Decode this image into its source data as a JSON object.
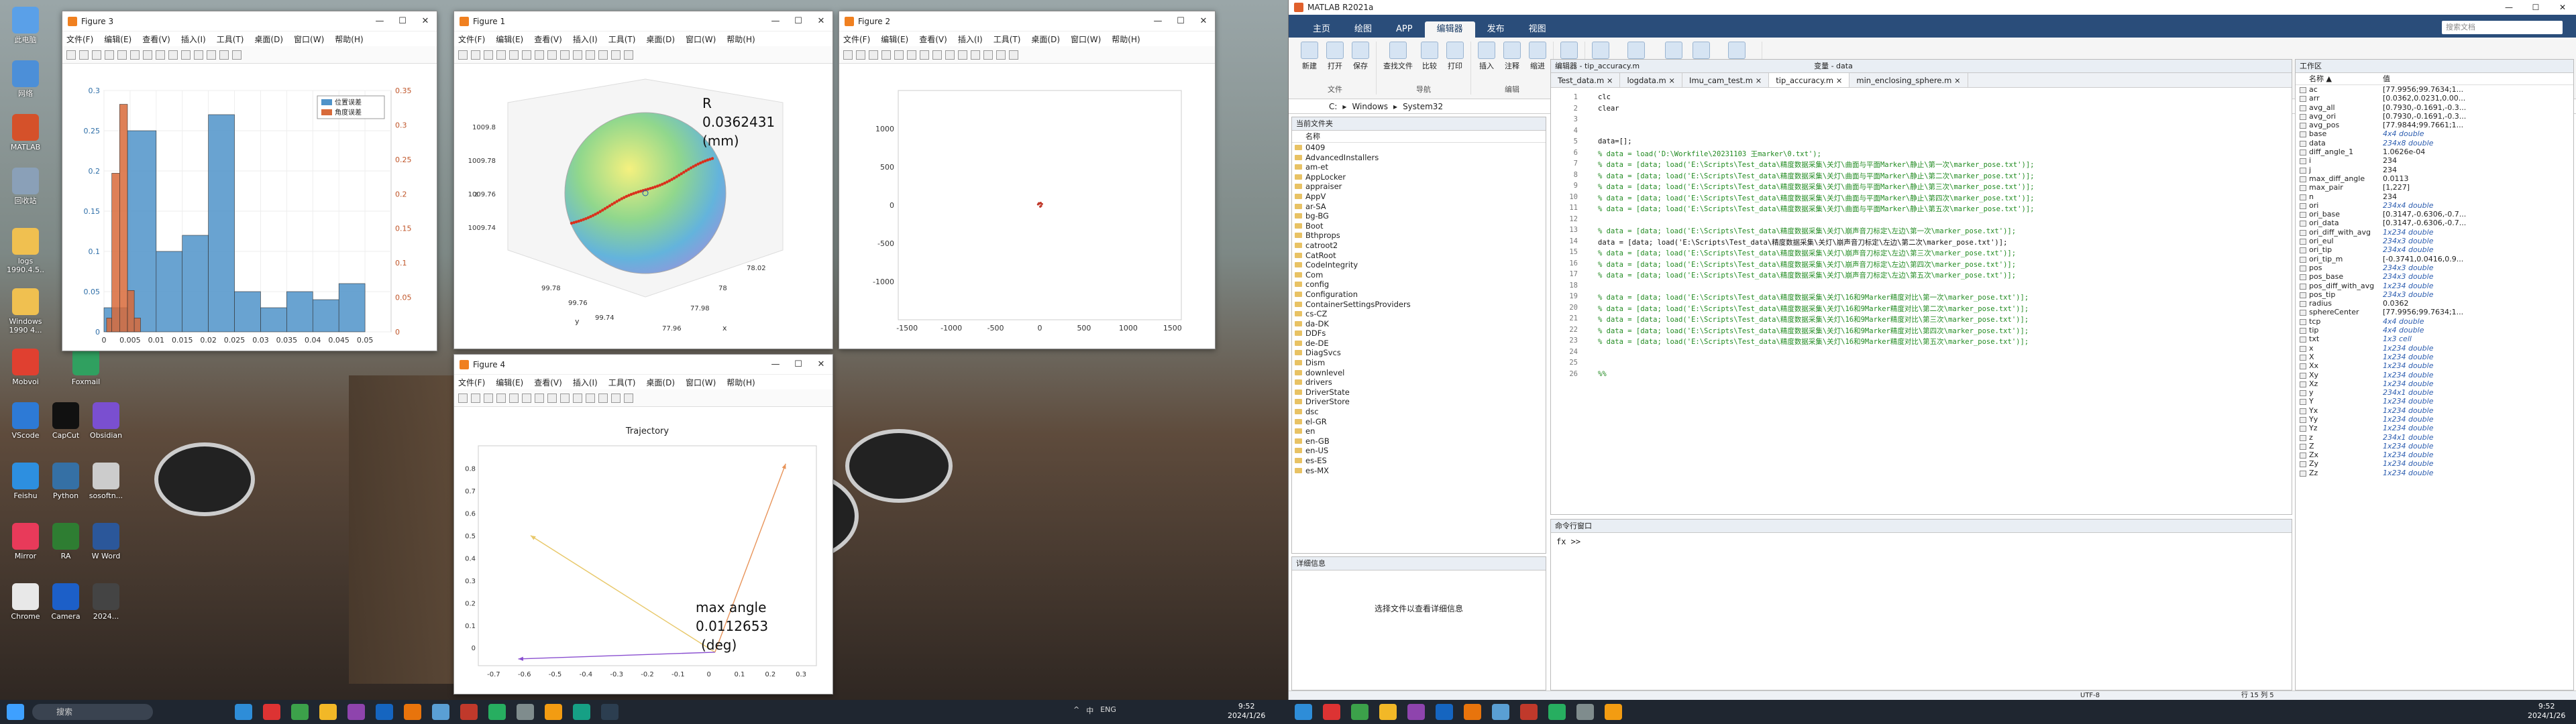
{
  "desktop": {
    "icons": [
      {
        "label": "此电脑",
        "color": "#5aa0e8"
      },
      {
        "label": "网络",
        "color": "#4c8fd8"
      },
      {
        "label": "MATLAB",
        "color": "#d5512a"
      },
      {
        "label": "回收站",
        "color": "#8aa0b8"
      },
      {
        "label": "logs\n1990.4.5..",
        "color": "#f0c050"
      },
      {
        "label": "Windows\n1990 4...",
        "color": "#f0c050"
      },
      {
        "label": "app",
        "color": "#f0c050"
      },
      {
        "label": "Mobvoi",
        "color": "#e04030"
      },
      {
        "label": "Foxmail",
        "color": "#30a060"
      },
      {
        "label": "VScode",
        "color": "#2d7ad6"
      },
      {
        "label": "CapCut",
        "color": "#111111"
      },
      {
        "label": "Obsidian",
        "color": "#7a4fd0"
      },
      {
        "label": "Feishu",
        "color": "#2d8fe0"
      },
      {
        "label": "Python",
        "color": "#3570a5"
      },
      {
        "label": "sosoftn...",
        "color": "#cccccc"
      },
      {
        "label": "Mirror",
        "color": "#e83a5a"
      },
      {
        "label": "RA",
        "color": "#2e7d32"
      },
      {
        "label": "W Word",
        "color": "#2b579a"
      },
      {
        "label": "Chrome",
        "color": "#e8e8e8"
      },
      {
        "label": "Camera",
        "color": "#1c5fc8"
      },
      {
        "label": "2024...",
        "color": "#444444"
      }
    ]
  },
  "figures": {
    "fig3": {
      "title": "Figure 3",
      "legend": [
        "位置误差",
        "角度误差"
      ],
      "menu": [
        "文件(F)",
        "编辑(E)",
        "查看(V)",
        "插入(I)",
        "工具(T)",
        "桌面(D)",
        "窗口(W)",
        "帮助(H)"
      ]
    },
    "fig1": {
      "title": "Figure 1",
      "annot_r": "R",
      "annot_v": "0.0362431",
      "annot_u": "(mm)",
      "menu": [
        "文件(F)",
        "编辑(E)",
        "查看(V)",
        "插入(I)",
        "工具(T)",
        "桌面(D)",
        "窗口(W)",
        "帮助(H)"
      ]
    },
    "fig2": {
      "title": "Figure 2",
      "menu": [
        "文件(F)",
        "编辑(E)",
        "查看(V)",
        "插入(I)",
        "工具(T)",
        "桌面(D)",
        "窗口(W)",
        "帮助(H)"
      ]
    },
    "fig4": {
      "title": "Figure 4",
      "axtitle": "Trajectory",
      "annot_a": "max angle",
      "annot_v": "0.0112653",
      "annot_u": "(deg)",
      "menu": [
        "文件(F)",
        "编辑(E)",
        "查看(V)",
        "插入(I)",
        "工具(T)",
        "桌面(D)",
        "窗口(W)",
        "帮助(H)"
      ]
    }
  },
  "chart_data": [
    {
      "type": "bar",
      "name": "histogram",
      "y_left_ticks": [
        "0",
        "0.05",
        "0.1",
        "0.15",
        "0.2",
        "0.25",
        "0.3"
      ],
      "y_right_ticks": [
        "0",
        "0.05",
        "0.1",
        "0.15",
        "0.2",
        "0.25",
        "0.3",
        "0.35"
      ],
      "x_ticks": [
        "0",
        "0.005",
        "0.01",
        "0.015",
        "0.02",
        "0.025",
        "0.03",
        "0.035",
        "0.04",
        "0.045",
        "0.05"
      ],
      "series": [
        {
          "name": "位置误差",
          "color": "#4f93c9",
          "bins": [
            [
              0,
              0.0045,
              0.03
            ],
            [
              0.0045,
              0.01,
              0.25
            ],
            [
              0.01,
              0.015,
              0.1
            ],
            [
              0.015,
              0.02,
              0.12
            ],
            [
              0.02,
              0.025,
              0.27
            ],
            [
              0.025,
              0.03,
              0.05
            ],
            [
              0.03,
              0.035,
              0.03
            ],
            [
              0.035,
              0.04,
              0.05
            ],
            [
              0.04,
              0.045,
              0.04
            ],
            [
              0.045,
              0.05,
              0.06
            ]
          ],
          "ylim": [
            0,
            0.3
          ]
        },
        {
          "name": "角度误差",
          "color": "#d86a3a",
          "bins": [
            [
              0.0005,
              0.0015,
              0.02
            ],
            [
              0.0015,
              0.003,
              0.23
            ],
            [
              0.003,
              0.0045,
              0.33
            ],
            [
              0.0045,
              0.0058,
              0.06
            ],
            [
              0.0058,
              0.007,
              0.02
            ]
          ],
          "ylim": [
            0,
            0.35
          ]
        }
      ]
    },
    {
      "type": "scatter",
      "name": "trajectory2d",
      "xlim": [
        -1600,
        1600
      ],
      "ylim": [
        -1500,
        1500
      ],
      "x_ticks": [
        "-1500",
        "-1000",
        "-500",
        "0",
        "500",
        "1000",
        "1500"
      ],
      "y_ticks": [
        "-1000",
        "-500",
        "0",
        "500",
        "1000"
      ],
      "points": [
        [
          0,
          20
        ],
        [
          10,
          30
        ],
        [
          -20,
          10
        ],
        [
          15,
          -10
        ],
        [
          25,
          15
        ],
        [
          5,
          -20
        ],
        [
          -10,
          25
        ]
      ]
    },
    {
      "type": "line",
      "name": "trajectory",
      "title": "Trajectory",
      "xlim": [
        -0.75,
        0.35
      ],
      "ylim": [
        -0.08,
        0.9
      ],
      "x_ticks": [
        "-0.7",
        "-0.6",
        "-0.5",
        "-0.4",
        "-0.3",
        "-0.2",
        "-0.1",
        "0",
        "0.1",
        "0.2",
        "0.3"
      ],
      "y_ticks": [
        "0",
        "0.1",
        "0.2",
        "0.3",
        "0.4",
        "0.5",
        "0.6",
        "0.7",
        "0.8"
      ],
      "series": [
        {
          "color": "#e8945a",
          "from": [
            0.02,
            -0.02
          ],
          "to": [
            0.25,
            0.82
          ]
        },
        {
          "color": "#e8c86a",
          "from": [
            0.02,
            -0.02
          ],
          "to": [
            -0.58,
            0.5
          ]
        },
        {
          "color": "#8a4fd0",
          "from": [
            0.02,
            -0.02
          ],
          "to": [
            -0.62,
            -0.05
          ]
        }
      ]
    },
    {
      "type": "scatter",
      "name": "sphere3d",
      "z_ticks": [
        "1009.8",
        "1009.78",
        "1009.76",
        "1009.74"
      ],
      "y_ticks": [
        "99.78",
        "99.76",
        "99.74"
      ],
      "x_ticks": [
        "77.96",
        "77.98",
        "78",
        "78.02"
      ],
      "xlabel": "x",
      "ylabel": "y",
      "zlabel": "z"
    }
  ],
  "matlab": {
    "title": "MATLAB R2021a",
    "tabs": [
      "主页",
      "绘图",
      "APP",
      "编辑器",
      "发布",
      "视图"
    ],
    "ribbon": {
      "groups": [
        {
          "label": "文件",
          "btns": [
            "新建",
            "打开",
            "保存"
          ]
        },
        {
          "label": "导航",
          "btns": [
            "查找文件",
            "比较",
            "打印"
          ]
        },
        {
          "label": "编辑",
          "btns": [
            "插入",
            "注释",
            "缩进"
          ]
        },
        {
          "label": "断点",
          "btns": [
            "断点"
          ]
        },
        {
          "label": "运行",
          "btns": [
            "运行",
            "运行并前进",
            "运行节",
            "前进",
            "运行并计时"
          ]
        }
      ]
    },
    "search_placeholder": "搜索文档",
    "address": [
      "C:",
      "Windows",
      "System32"
    ],
    "folder_title": "当前文件夹",
    "folder_header": "名称",
    "folders": [
      "0409",
      "AdvancedInstallers",
      "am-et",
      "AppLocker",
      "appraiser",
      "AppV",
      "ar-SA",
      "bg-BG",
      "Boot",
      "Bthprops",
      "catroot2",
      "CatRoot",
      "CodeIntegrity",
      "Com",
      "config",
      "Configuration",
      "ContainerSettingsProviders",
      "cs-CZ",
      "da-DK",
      "DDFs",
      "de-DE",
      "DiagSvcs",
      "Dism",
      "downlevel",
      "drivers",
      "DriverState",
      "DriverStore",
      "dsc",
      "el-GR",
      "en",
      "en-GB",
      "en-US",
      "es-ES",
      "es-MX"
    ],
    "details_title": "详细信息",
    "details_text": "选择文件以查看详细信息",
    "editor_title": "编辑器 - tip_accuracy.m",
    "vars_title": "变量 - data",
    "editor_tabs": [
      "Test_data.m",
      "logdata.m",
      "Imu_cam_test.m",
      "tip_accuracy.m",
      "min_enclosing_sphere.m"
    ],
    "code": [
      {
        "n": "1",
        "t": "clc",
        "c": false
      },
      {
        "n": "2",
        "t": "clear",
        "c": false
      },
      {
        "n": "3",
        "t": "",
        "c": false
      },
      {
        "n": "4",
        "t": "",
        "c": false
      },
      {
        "n": "5",
        "t": "data=[];",
        "c": false
      },
      {
        "n": "6",
        "t": "% data = load('D:\\Workfile\\20231103 王marker\\0.txt');",
        "c": true
      },
      {
        "n": "7",
        "t": "% data = [data; load('E:\\Scripts\\Test_data\\精度数据采集\\关灯\\曲面与平面Marker\\静止\\第一次\\marker_pose.txt')];",
        "c": true
      },
      {
        "n": "8",
        "t": "% data = [data; load('E:\\Scripts\\Test_data\\精度数据采集\\关灯\\曲面与平面Marker\\静止\\第二次\\marker_pose.txt')];",
        "c": true
      },
      {
        "n": "9",
        "t": "% data = [data; load('E:\\Scripts\\Test_data\\精度数据采集\\关灯\\曲面与平面Marker\\静止\\第三次\\marker_pose.txt')];",
        "c": true
      },
      {
        "n": "10",
        "t": "% data = [data; load('E:\\Scripts\\Test_data\\精度数据采集\\关灯\\曲面与平面Marker\\静止\\第四次\\marker_pose.txt')];",
        "c": true
      },
      {
        "n": "11",
        "t": "% data = [data; load('E:\\Scripts\\Test_data\\精度数据采集\\关灯\\曲面与平面Marker\\静止\\第五次\\marker_pose.txt')];",
        "c": true
      },
      {
        "n": "12",
        "t": "",
        "c": false
      },
      {
        "n": "13",
        "t": "% data = [data; load('E:\\Scripts\\Test_data\\精度数据采集\\关灯\\崩声音刀标定\\左边\\第一次\\marker_pose.txt')];",
        "c": true
      },
      {
        "n": "14",
        "t": "data = [data; load('E:\\Scripts\\Test_data\\精度数据采集\\关灯\\崩声音刀标定\\左边\\第二次\\marker_pose.txt')];",
        "c": false
      },
      {
        "n": "15",
        "t": "% data = [data; load('E:\\Scripts\\Test_data\\精度数据采集\\关灯\\崩声音刀标定\\左边\\第三次\\marker_pose.txt')];",
        "c": true
      },
      {
        "n": "16",
        "t": "% data = [data; load('E:\\Scripts\\Test_data\\精度数据采集\\关灯\\崩声音刀标定\\左边\\第四次\\marker_pose.txt')];",
        "c": true
      },
      {
        "n": "17",
        "t": "% data = [data; load('E:\\Scripts\\Test_data\\精度数据采集\\关灯\\崩声音刀标定\\左边\\第五次\\marker_pose.txt')];",
        "c": true
      },
      {
        "n": "18",
        "t": "",
        "c": false
      },
      {
        "n": "19",
        "t": "% data = [data; load('E:\\Scripts\\Test_data\\精度数据采集\\关灯\\16和9Marker精度对比\\第一次\\marker_pose.txt')];",
        "c": true
      },
      {
        "n": "20",
        "t": "% data = [data; load('E:\\Scripts\\Test_data\\精度数据采集\\关灯\\16和9Marker精度对比\\第二次\\marker_pose.txt')];",
        "c": true
      },
      {
        "n": "21",
        "t": "% data = [data; load('E:\\Scripts\\Test_data\\精度数据采集\\关灯\\16和9Marker精度对比\\第三次\\marker_pose.txt')];",
        "c": true
      },
      {
        "n": "22",
        "t": "% data = [data; load('E:\\Scripts\\Test_data\\精度数据采集\\关灯\\16和9Marker精度对比\\第四次\\marker_pose.txt')];",
        "c": true
      },
      {
        "n": "23",
        "t": "% data = [data; load('E:\\Scripts\\Test_data\\精度数据采集\\关灯\\16和9Marker精度对比\\第五次\\marker_pose.txt')];",
        "c": true
      },
      {
        "n": "24",
        "t": "",
        "c": false
      },
      {
        "n": "25",
        "t": "",
        "c": false
      },
      {
        "n": "26",
        "t": "%%",
        "c": true
      }
    ],
    "cmd_title": "命令行窗口",
    "cmd_prompt": "fx >>",
    "ws_title": "工作区",
    "ws_header_name": "名称 ▲",
    "ws_header_value": "值",
    "workspace": [
      {
        "n": "ac",
        "v": "[77.9956;99.7634;1..."
      },
      {
        "n": "arr",
        "v": "[0.0362,0.0231,0.00..."
      },
      {
        "n": "avg_all",
        "v": "[0.7930,-0.1691,-0.3..."
      },
      {
        "n": "avg_ori",
        "v": "[0.7930,-0.1691,-0.3..."
      },
      {
        "n": "avg_pos",
        "v": "[77.9844;99.7661;1..."
      },
      {
        "n": "base",
        "v": "4x4 double",
        "i": true
      },
      {
        "n": "data",
        "v": "234x8 double",
        "i": true
      },
      {
        "n": "diff_angle_1",
        "v": "1.0626e-04"
      },
      {
        "n": "i",
        "v": "234"
      },
      {
        "n": "j",
        "v": "234"
      },
      {
        "n": "max_diff_angle",
        "v": "0.0113"
      },
      {
        "n": "max_pair",
        "v": "[1,227]"
      },
      {
        "n": "n",
        "v": "234"
      },
      {
        "n": "ori",
        "v": "234x4 double",
        "i": true
      },
      {
        "n": "ori_base",
        "v": "[0.3147,-0.6306,-0.7..."
      },
      {
        "n": "ori_data",
        "v": "[0.3147,-0.6306,-0.7..."
      },
      {
        "n": "ori_diff_with_avg",
        "v": "1x234 double",
        "i": true
      },
      {
        "n": "ori_eul",
        "v": "234x3 double",
        "i": true
      },
      {
        "n": "ori_tip",
        "v": "234x4 double",
        "i": true
      },
      {
        "n": "ori_tip_m",
        "v": "[-0.3741,0.0416,0.9..."
      },
      {
        "n": "pos",
        "v": "234x3 double",
        "i": true
      },
      {
        "n": "pos_base",
        "v": "234x3 double",
        "i": true
      },
      {
        "n": "pos_diff_with_avg",
        "v": "1x234 double",
        "i": true
      },
      {
        "n": "pos_tip",
        "v": "234x3 double",
        "i": true
      },
      {
        "n": "radius",
        "v": "0.0362"
      },
      {
        "n": "sphereCenter",
        "v": "[77.9956;99.7634;1..."
      },
      {
        "n": "tcp",
        "v": "4x4 double",
        "i": true
      },
      {
        "n": "tip",
        "v": "4x4 double",
        "i": true
      },
      {
        "n": "txt",
        "v": "1x3 cell",
        "i": true
      },
      {
        "n": "x",
        "v": "1x234 double",
        "i": true
      },
      {
        "n": "X",
        "v": "1x234 double",
        "i": true
      },
      {
        "n": "Xx",
        "v": "1x234 double",
        "i": true
      },
      {
        "n": "Xy",
        "v": "1x234 double",
        "i": true
      },
      {
        "n": "Xz",
        "v": "1x234 double",
        "i": true
      },
      {
        "n": "y",
        "v": "234x1 double",
        "i": true
      },
      {
        "n": "Y",
        "v": "1x234 double",
        "i": true
      },
      {
        "n": "Yx",
        "v": "1x234 double",
        "i": true
      },
      {
        "n": "Yy",
        "v": "1x234 double",
        "i": true
      },
      {
        "n": "Yz",
        "v": "1x234 double",
        "i": true
      },
      {
        "n": "z",
        "v": "234x1 double",
        "i": true
      },
      {
        "n": "Z",
        "v": "1x234 double",
        "i": true
      },
      {
        "n": "Zx",
        "v": "1x234 double",
        "i": true
      },
      {
        "n": "Zy",
        "v": "1x234 double",
        "i": true
      },
      {
        "n": "Zz",
        "v": "1x234 double",
        "i": true
      }
    ],
    "status_encoding": "UTF-8",
    "status_pos": "行 15   列 5"
  },
  "taskbar": {
    "search": "搜索",
    "clock_left": {
      "time": "9:52",
      "date": "2024/1/26"
    },
    "clock_right": {
      "time": "9:52",
      "date": "2024/1/26"
    },
    "tray_left": [
      "^",
      "中",
      "ENG"
    ],
    "app_colors": [
      "#2e8dd8",
      "#d33",
      "#3ca14a",
      "#f2b827",
      "#8e44ad",
      "#1565c0",
      "#e8740c",
      "#5a9fd4",
      "#c0392b",
      "#27ae60",
      "#7f8c8d",
      "#f39c12",
      "#16a085",
      "#2c3e50"
    ]
  }
}
